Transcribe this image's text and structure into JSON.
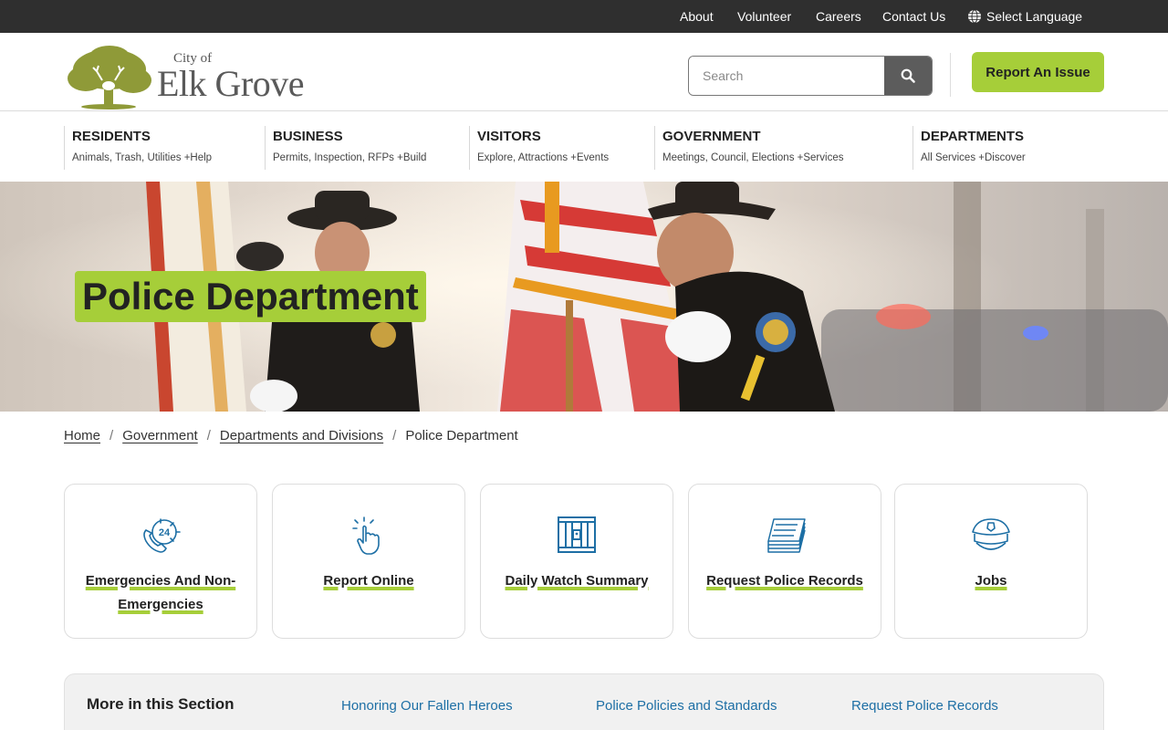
{
  "topbar": {
    "links": [
      "About",
      "Volunteer",
      "Careers",
      "Contact Us"
    ],
    "language": "Select Language"
  },
  "header": {
    "logo_city_of": "City of",
    "logo_name": "Elk Grove",
    "search_placeholder": "Search",
    "report_button": "Report An Issue"
  },
  "nav": [
    {
      "title": "RESIDENTS",
      "subtitle": "Animals, Trash, Utilities +Help"
    },
    {
      "title": "BUSINESS",
      "subtitle": "Permits, Inspection, RFPs +Build"
    },
    {
      "title": "VISITORS",
      "subtitle": "Explore, Attractions +Events"
    },
    {
      "title": "GOVERNMENT",
      "subtitle": "Meetings, Council, Elections +Services"
    },
    {
      "title": "DEPARTMENTS",
      "subtitle": "All Services +Discover"
    }
  ],
  "hero": {
    "title": "Police Department"
  },
  "breadcrumb": [
    "Home",
    "Government",
    "Departments and Divisions",
    "Police Department"
  ],
  "cards": [
    {
      "label": "Emergencies And Non-Emergencies",
      "icon": "phone-24-icon"
    },
    {
      "label": "Report Online",
      "icon": "hand-click-icon"
    },
    {
      "label": "Daily Watch Summary",
      "icon": "jail-cell-icon"
    },
    {
      "label": "Request Police Records",
      "icon": "records-stack-icon"
    },
    {
      "label": "Jobs",
      "icon": "police-hat-icon"
    }
  ],
  "more": {
    "title": "More in this Section",
    "links": [
      "Honoring Our Fallen Heroes",
      "Police Policies and Standards",
      "Request Police Records"
    ]
  },
  "colors": {
    "accent_green": "#a6ce39",
    "topbar": "#2f2f2f",
    "icon_blue": "#1d6fa5",
    "link_blue": "#1d6fa5"
  }
}
